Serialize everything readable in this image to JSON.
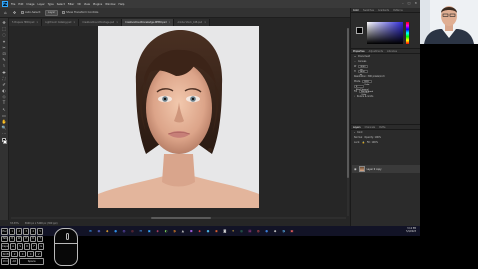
{
  "menubar": {
    "logo": "Ps",
    "items": [
      "File",
      "Edit",
      "Image",
      "Layer",
      "Type",
      "Select",
      "Filter",
      "3D",
      "View",
      "Plugins",
      "Window",
      "Help"
    ],
    "window_controls": [
      "–",
      "□",
      "✕"
    ]
  },
  "options": {
    "auto_select_label": "Auto-Select:",
    "layer_select": "Layer",
    "transform_label": "Show Transform Controls",
    "share_label": "Share"
  },
  "tabs": [
    {
      "label": "5 Prepare HDRI.psd",
      "active": false
    },
    {
      "label": "Lightroom Catalog.psd",
      "active": false
    },
    {
      "label": "CreativeCloud-Montage.psd",
      "active": false
    },
    {
      "label": "CreativeCloudKnowledge-DEMO.psd",
      "active": true
    },
    {
      "label": "Adobe Stock_448.psd",
      "active": false
    }
  ],
  "tools": [
    "✥",
    "⬚",
    "◌",
    "⌖",
    "✂",
    "⊡",
    "✎",
    "⌇",
    "✚",
    "⛶",
    "✐",
    "◐",
    "◇",
    "T",
    "↖",
    "▭",
    "✋",
    "🔍",
    "⋯"
  ],
  "statusbar": {
    "zoom": "33.33%",
    "doc_info": "3600 px x 5400 px (300 ppi)"
  },
  "panels": {
    "color_tabs": [
      "Color",
      "Swatches",
      "Gradients",
      "Patterns"
    ],
    "props_tabs": [
      "Properties",
      "Adjustments",
      "Libraries"
    ],
    "props_title": "Document",
    "canvas_label": "Canvas",
    "w_label": "W",
    "w_value": "3600 px",
    "h_label": "H",
    "h_value": "5400 px",
    "resolution_label": "Resolution: 300 pixels/inch",
    "mode_label": "Mode",
    "mode_value": "RGB Color",
    "depth_value": "8 Bits/Channel",
    "fill_label": "Fill",
    "fill_value": "Background Color",
    "rulers_label": "Rulers & Grids",
    "layer_tabs": [
      "Layers",
      "Channels",
      "Paths"
    ],
    "kind_label": "Kind",
    "normal_label": "Normal",
    "opacity_label": "Opacity: 100%",
    "lock_label": "Lock:",
    "fill_pct_label": "Fill: 100%",
    "layer_name": "Layer 0 copy"
  },
  "taskbar": {
    "icons": [
      {
        "glyph": "⊞",
        "color": "#3aa0ff"
      },
      {
        "glyph": "◉",
        "color": "#5b6bd6"
      },
      {
        "glyph": "◆",
        "color": "#e0a030"
      },
      {
        "glyph": "●",
        "color": "#2f8fe8"
      },
      {
        "glyph": "◍",
        "color": "#7a5be0"
      },
      {
        "glyph": "◎",
        "color": "#e04848"
      },
      {
        "glyph": "✉",
        "color": "#4aa6ff"
      },
      {
        "glyph": "▣",
        "color": "#31a8ff"
      },
      {
        "glyph": "◈",
        "color": "#e94b77"
      },
      {
        "glyph": "◐",
        "color": "#7ad05a"
      },
      {
        "glyph": "◑",
        "color": "#f08a24"
      },
      {
        "glyph": "▲",
        "color": "#c0c0c0"
      },
      {
        "glyph": "◼",
        "color": "#9c5bd6"
      },
      {
        "glyph": "◆",
        "color": "#d84040"
      },
      {
        "glyph": "●",
        "color": "#48b0e0"
      },
      {
        "glyph": "◉",
        "color": "#e06030"
      },
      {
        "glyph": "◙",
        "color": "#dcdcdc"
      },
      {
        "glyph": "✦",
        "color": "#f0c040"
      },
      {
        "glyph": "◎",
        "color": "#40c080"
      },
      {
        "glyph": "▤",
        "color": "#c040a0"
      },
      {
        "glyph": "◍",
        "color": "#e05050"
      },
      {
        "glyph": "●",
        "color": "#3a7bd5"
      },
      {
        "glyph": "◆",
        "color": "#d0d0d0"
      },
      {
        "glyph": "◑",
        "color": "#5fc0ff"
      },
      {
        "glyph": "▣",
        "color": "#f06060"
      }
    ],
    "time": "3:12 PM",
    "date": "5/4/2023"
  },
  "keyboard": {
    "keys": [
      "Esc",
      "1",
      "2",
      "3",
      "4",
      "5",
      "Tab",
      "Q",
      "W",
      "E",
      "R",
      "T",
      "Caps",
      "A",
      "S",
      "D",
      "F",
      "G",
      "Shift",
      "Z",
      "X",
      "C",
      "V",
      "Ctrl",
      "Alt",
      "Space"
    ]
  }
}
